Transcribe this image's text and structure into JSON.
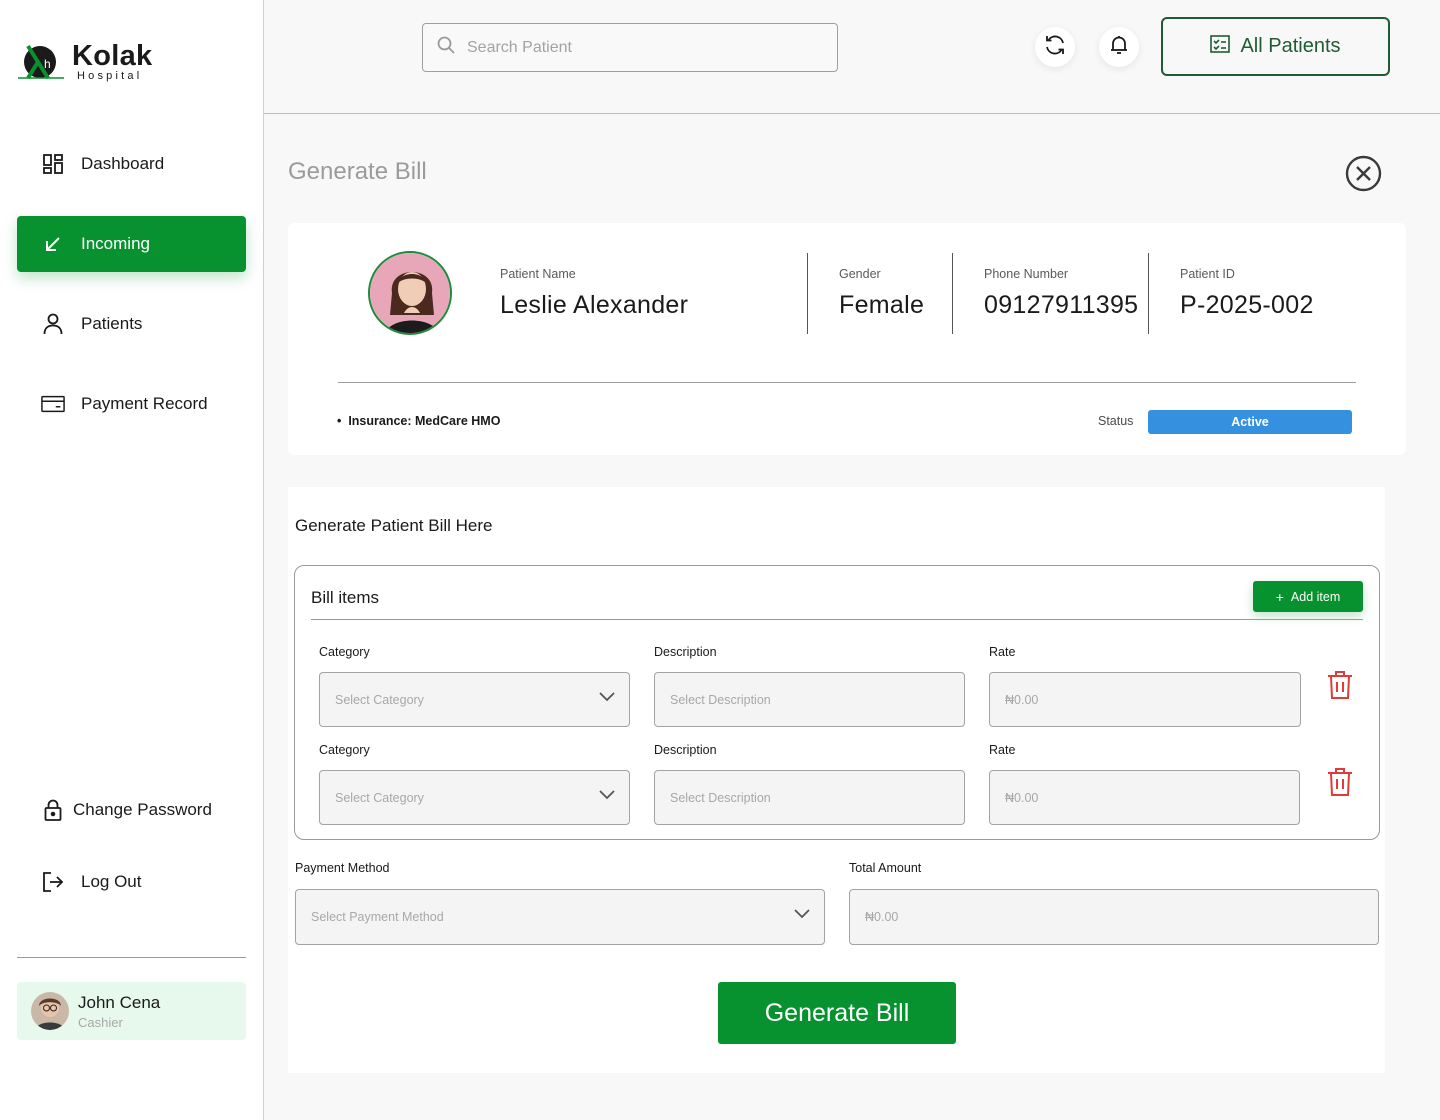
{
  "brand": {
    "name": "Kolak",
    "sub": "Hospital",
    "color": "#07922f"
  },
  "sidebar": {
    "items": [
      {
        "label": "Dashboard",
        "icon": "dashboard-icon"
      },
      {
        "label": "Incoming",
        "icon": "arrow-down-left-icon",
        "active": true
      },
      {
        "label": "Patients",
        "icon": "user-icon"
      },
      {
        "label": "Payment Record",
        "icon": "card-icon"
      }
    ],
    "bottom": [
      {
        "label": "Change Password",
        "icon": "lock-icon"
      },
      {
        "label": "Log Out",
        "icon": "logout-icon"
      }
    ],
    "user": {
      "name": "John Cena",
      "role": "Cashier"
    }
  },
  "topbar": {
    "search_placeholder": "Search Patient",
    "all_patients_label": "All Patients"
  },
  "page": {
    "title": "Generate Bill"
  },
  "patient": {
    "name_label": "Patient Name",
    "name": "Leslie Alexander",
    "gender_label": "Gender",
    "gender": "Female",
    "phone_label": "Phone Number",
    "phone": "09127911395",
    "id_label": "Patient ID",
    "id": "P-2025-002",
    "insurance": "Insurance: MedCare HMO",
    "status_label": "Status",
    "status": "Active",
    "status_color": "#3591e0"
  },
  "bill": {
    "heading": "Generate Patient Bill Here",
    "items_title": "Bill items",
    "add_item_label": "Add item",
    "rows": [
      {
        "category_label": "Category",
        "category_placeholder": "Select Category",
        "description_label": "Description",
        "description_placeholder": "Select Description",
        "rate_label": "Rate",
        "rate_placeholder": "₦0.00"
      },
      {
        "category_label": "Category",
        "category_placeholder": "Select Category",
        "description_label": "Description",
        "description_placeholder": "Select Description",
        "rate_label": "Rate",
        "rate_placeholder": "₦0.00"
      }
    ],
    "payment_method_label": "Payment Method",
    "payment_method_placeholder": "Select Payment Method",
    "total_label": "Total Amount",
    "total_placeholder": "₦0.00",
    "generate_label": "Generate Bill"
  }
}
